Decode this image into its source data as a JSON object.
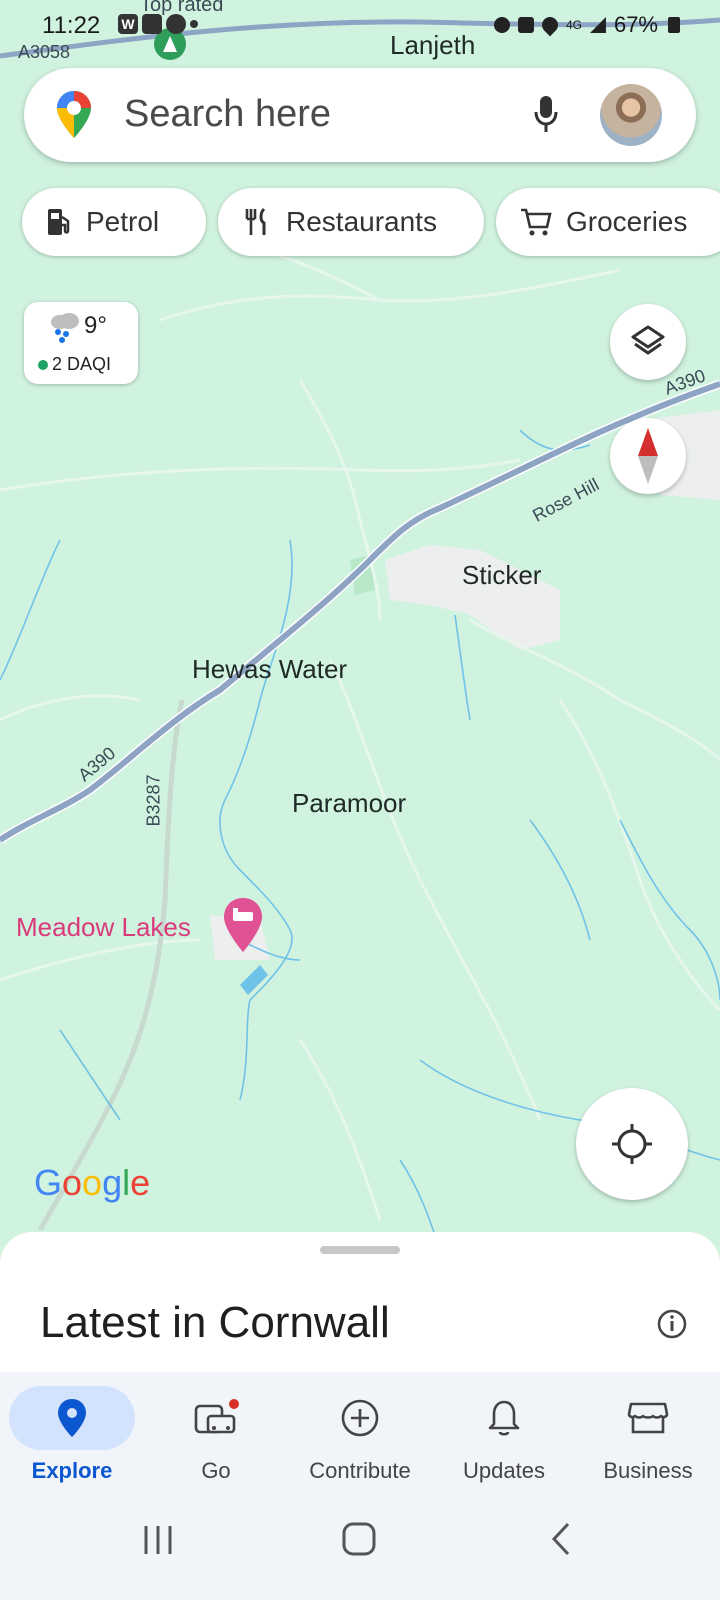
{
  "status_bar": {
    "time": "11:22",
    "battery": "67%",
    "network": "4G"
  },
  "map": {
    "places": {
      "lanjeth": "Lanjeth",
      "sticker": "Sticker",
      "hewas_water": "Hewas Water",
      "paramoor": "Paramoor",
      "meadow_lakes": "Meadow Lakes",
      "top_rated": "Top rated"
    },
    "roads": {
      "a3058": "A3058",
      "a390_top": "A390",
      "a390_left": "A390",
      "b3287": "B3287",
      "rose_hill": "Rose Hill"
    },
    "google_logo": [
      "G",
      "o",
      "o",
      "g",
      "l",
      "e"
    ],
    "google_colors": [
      "#4285F4",
      "#EA4335",
      "#FBBC05",
      "#4285F4",
      "#34A853",
      "#EA4335"
    ]
  },
  "search": {
    "placeholder": "Search here"
  },
  "chips": [
    {
      "label": "Petrol",
      "icon": "fuel-icon"
    },
    {
      "label": "Restaurants",
      "icon": "restaurant-icon"
    },
    {
      "label": "Groceries",
      "icon": "cart-icon"
    }
  ],
  "weather": {
    "temperature": "9°",
    "aqi": "2 DAQI",
    "icon": "rain-cloud-icon"
  },
  "bottom_sheet": {
    "title": "Latest in Cornwall"
  },
  "nav": {
    "items": [
      {
        "label": "Explore",
        "icon": "explore-pin-icon",
        "active": true
      },
      {
        "label": "Go",
        "icon": "commute-icon",
        "active": false
      },
      {
        "label": "Contribute",
        "icon": "add-circle-icon",
        "active": false
      },
      {
        "label": "Updates",
        "icon": "bell-icon",
        "active": false
      },
      {
        "label": "Business",
        "icon": "storefront-icon",
        "active": false
      }
    ]
  },
  "colors": {
    "map_bg": "#d0f3df",
    "road_major": "#8ea4c4",
    "accent_blue": "#0b57d0",
    "hotel_pink": "#d93a7a",
    "compass_red": "#d32f2f"
  }
}
